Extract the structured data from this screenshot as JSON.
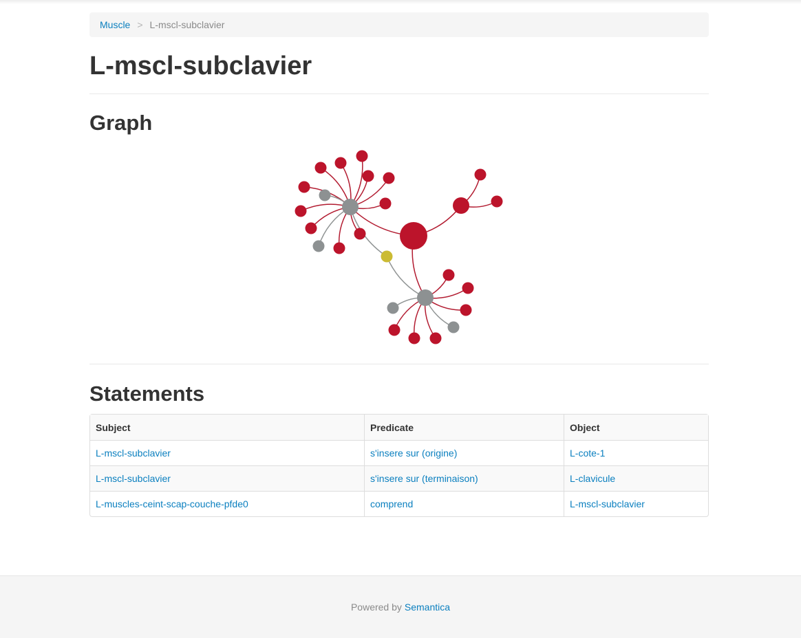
{
  "breadcrumb": {
    "parent": "Muscle",
    "separator": ">",
    "current": "L-mscl-subclavier"
  },
  "page_title": "L-mscl-subclavier",
  "graph": {
    "heading": "Graph",
    "colors": {
      "red": "#bc142b",
      "gray": "#8d9192",
      "yellow": "#cbbb33"
    },
    "nodes": [
      {
        "id": "center",
        "color": "red",
        "size": "large"
      },
      {
        "id": "hub1",
        "color": "gray",
        "size": "medium"
      },
      {
        "id": "hub2",
        "color": "gray",
        "size": "medium"
      },
      {
        "id": "hub3",
        "color": "red",
        "size": "medium"
      },
      {
        "id": "yellow",
        "color": "yellow",
        "size": "small"
      },
      {
        "id": "a1",
        "color": "red",
        "size": "small"
      },
      {
        "id": "a2",
        "color": "red",
        "size": "small"
      },
      {
        "id": "a3",
        "color": "red",
        "size": "small"
      },
      {
        "id": "a4",
        "color": "red",
        "size": "small"
      },
      {
        "id": "a5",
        "color": "red",
        "size": "small"
      },
      {
        "id": "a6",
        "color": "red",
        "size": "small"
      },
      {
        "id": "a7",
        "color": "red",
        "size": "small"
      },
      {
        "id": "a8",
        "color": "red",
        "size": "small"
      },
      {
        "id": "a9",
        "color": "red",
        "size": "small"
      },
      {
        "id": "a10",
        "color": "red",
        "size": "small"
      },
      {
        "id": "a11",
        "color": "red",
        "size": "small"
      },
      {
        "id": "a12",
        "color": "gray",
        "size": "small"
      },
      {
        "id": "a13",
        "color": "gray",
        "size": "small"
      },
      {
        "id": "b1",
        "color": "red",
        "size": "small"
      },
      {
        "id": "b2",
        "color": "red",
        "size": "small"
      },
      {
        "id": "b3",
        "color": "red",
        "size": "small"
      },
      {
        "id": "b4",
        "color": "red",
        "size": "small"
      },
      {
        "id": "b5",
        "color": "red",
        "size": "small"
      },
      {
        "id": "b6",
        "color": "red",
        "size": "small"
      },
      {
        "id": "b7",
        "color": "gray",
        "size": "small"
      },
      {
        "id": "b8",
        "color": "gray",
        "size": "small"
      },
      {
        "id": "c1",
        "color": "red",
        "size": "small"
      },
      {
        "id": "c2",
        "color": "red",
        "size": "small"
      }
    ],
    "edges": [
      {
        "from": "hub1",
        "to": "center",
        "color": "red"
      },
      {
        "from": "center",
        "to": "hub2",
        "color": "red"
      },
      {
        "from": "center",
        "to": "hub3",
        "color": "red"
      },
      {
        "from": "hub1",
        "to": "yellow",
        "color": "gray"
      },
      {
        "from": "yellow",
        "to": "hub2",
        "color": "gray"
      },
      {
        "from": "hub1",
        "to": "a1",
        "color": "red"
      },
      {
        "from": "hub1",
        "to": "a2",
        "color": "red"
      },
      {
        "from": "hub1",
        "to": "a3",
        "color": "red"
      },
      {
        "from": "hub1",
        "to": "a4",
        "color": "red"
      },
      {
        "from": "hub1",
        "to": "a5",
        "color": "red"
      },
      {
        "from": "hub1",
        "to": "a6",
        "color": "red"
      },
      {
        "from": "hub1",
        "to": "a7",
        "color": "red"
      },
      {
        "from": "hub1",
        "to": "a8",
        "color": "red"
      },
      {
        "from": "hub1",
        "to": "a9",
        "color": "red"
      },
      {
        "from": "hub1",
        "to": "a10",
        "color": "red"
      },
      {
        "from": "hub1",
        "to": "a11",
        "color": "red"
      },
      {
        "from": "hub1",
        "to": "a12",
        "color": "gray"
      },
      {
        "from": "hub1",
        "to": "a13",
        "color": "gray"
      },
      {
        "from": "hub2",
        "to": "b1",
        "color": "red"
      },
      {
        "from": "hub2",
        "to": "b2",
        "color": "red"
      },
      {
        "from": "hub2",
        "to": "b3",
        "color": "red"
      },
      {
        "from": "hub2",
        "to": "b4",
        "color": "red"
      },
      {
        "from": "hub2",
        "to": "b5",
        "color": "red"
      },
      {
        "from": "hub2",
        "to": "b6",
        "color": "red"
      },
      {
        "from": "hub2",
        "to": "b7",
        "color": "gray"
      },
      {
        "from": "hub2",
        "to": "b8",
        "color": "gray"
      },
      {
        "from": "hub3",
        "to": "c1",
        "color": "red"
      },
      {
        "from": "hub3",
        "to": "c2",
        "color": "red"
      }
    ]
  },
  "statements": {
    "heading": "Statements",
    "columns": [
      "Subject",
      "Predicate",
      "Object"
    ],
    "rows": [
      [
        "L-mscl-subclavier",
        "s'insere sur (origine)",
        "L-cote-1"
      ],
      [
        "L-mscl-subclavier",
        "s'insere sur (terminaison)",
        "L-clavicule"
      ],
      [
        "L-muscles-ceint-scap-couche-pfde0",
        "comprend",
        "L-mscl-subclavier"
      ]
    ]
  },
  "footer": {
    "prefix": "Powered by",
    "link": "Semantica"
  }
}
